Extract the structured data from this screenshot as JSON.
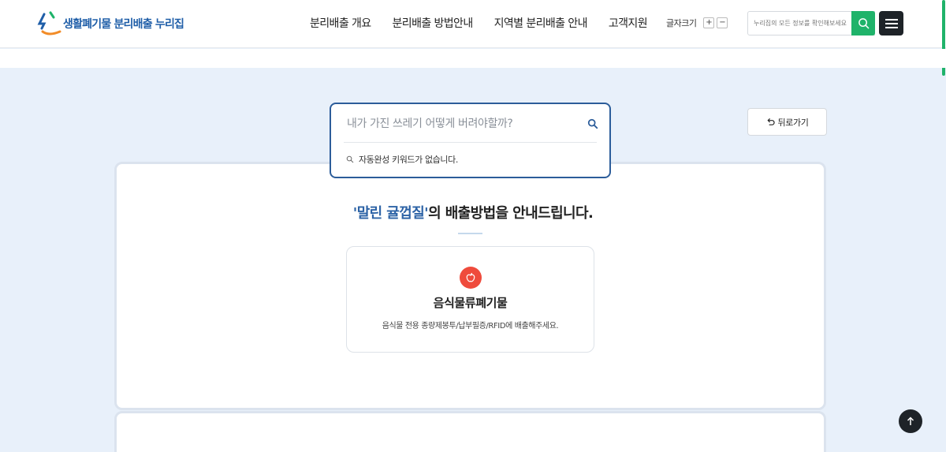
{
  "header": {
    "logo_text": "생활폐기물 분리배출 누리집",
    "nav": [
      {
        "label": "분리배출 개요"
      },
      {
        "label": "분리배출 방법안내"
      },
      {
        "label": "지역별 분리배출 안내"
      },
      {
        "label": "고객지원"
      }
    ],
    "font_size_label": "글자크기",
    "font_plus": "+",
    "font_minus": "−",
    "search_placeholder": "누리집의 모든 정보를 확인해보세요",
    "accent_color": "#1fb36a"
  },
  "search": {
    "placeholder": "내가 가진 쓰레기 어떻게 버려야할까?",
    "autocomplete_empty": "자동완성 키워드가 없습니다."
  },
  "back_button": {
    "label": "뒤로가기"
  },
  "result": {
    "keyword": "'말린 귤껍질'",
    "headline_suffix": "의 배출방법을 안내드립니다.",
    "category": "음식물류폐기물",
    "description": "음식물 전용 종량제봉투/납부필증/RFID에 배출해주세요.",
    "icon": "apple-icon",
    "icon_color": "#ef4b3c"
  }
}
